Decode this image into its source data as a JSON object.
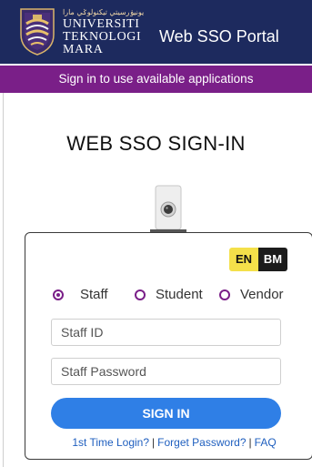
{
  "header": {
    "jawi": "يونيۏرسيتي تيکنولوݢي مارا",
    "university_lines": [
      "UNIVERSITI",
      "TEKNOLOGI",
      "MARA"
    ],
    "portal_title": "Web SSO Portal"
  },
  "subbar": {
    "text": "Sign in to use available applications"
  },
  "main": {
    "title": "WEB SSO SIGN-IN"
  },
  "language": {
    "en": "EN",
    "bm": "BM",
    "active": "EN"
  },
  "user_type": {
    "selected": "Staff",
    "options": [
      {
        "label": "Staff"
      },
      {
        "label": "Student"
      },
      {
        "label": "Vendor"
      }
    ]
  },
  "form": {
    "id_placeholder": "Staff ID",
    "id_value": "",
    "password_placeholder": "Staff Password",
    "password_value": "",
    "submit_label": "SIGN IN"
  },
  "links": {
    "first_time": "1st Time Login?",
    "sep1": "|",
    "forget": "Forget Password?",
    "sep2": "|",
    "faq": "FAQ"
  },
  "colors": {
    "header_bg": "#1d2a5e",
    "subbar_bg": "#7a1f88",
    "radio_accent": "#7a1f88",
    "button_bg": "#2f7fe6",
    "lang_en_bg": "#f4e04a",
    "lang_bm_bg": "#1c1c1c",
    "link": "#1f5fbf"
  },
  "icons": {
    "crest": "uitm-crest-icon",
    "camera": "webcam-icon"
  }
}
